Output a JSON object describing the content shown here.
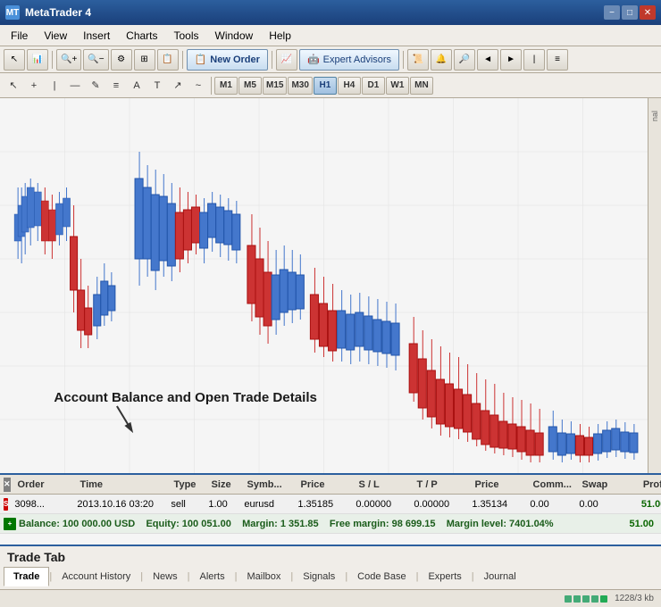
{
  "titlebar": {
    "title": "MetaTrader 4",
    "minimize": "−",
    "maximize": "□",
    "close": "✕"
  },
  "menu": {
    "items": [
      "File",
      "View",
      "Insert",
      "Charts",
      "Tools",
      "Window",
      "Help"
    ]
  },
  "toolbar1": {
    "new_order": "New Order",
    "expert_advisors": "Expert Advisors"
  },
  "toolbar2": {
    "timeframes": [
      "M1",
      "M5",
      "M15",
      "M30",
      "H1",
      "H4",
      "D1",
      "W1",
      "MN"
    ],
    "active_tf": "H1"
  },
  "chart": {
    "annotation": "Account Balance and Open Trade Details"
  },
  "trade_table": {
    "headers": [
      "Order",
      "Time",
      "Type",
      "Size",
      "Symb...",
      "Price",
      "S / L",
      "T / P",
      "Price",
      "Comm...",
      "Swap",
      "Profit"
    ],
    "rows": [
      {
        "order": "3098...",
        "time": "2013.10.16 03:20",
        "type": "sell",
        "size": "1.00",
        "symbol": "eurusd",
        "price": "1.35185",
        "sl": "0.00000",
        "tp": "0.00000",
        "price2": "1.35134",
        "comm": "0.00",
        "swap": "0.00",
        "profit": "51.00"
      }
    ],
    "balance_row": "Balance: 100 000.00 USD   Equity: 100 051.00   Margin: 1 351.85   Free margin: 98 699.15   Margin level: 7401.04%",
    "balance_profit": "51.00"
  },
  "tabs": {
    "items": [
      "Trade",
      "Account History",
      "News",
      "Alerts",
      "Mailbox",
      "Signals",
      "Code Base",
      "Experts",
      "Journal"
    ],
    "active": "Trade"
  },
  "labels": {
    "trade_tab": "Trade Tab"
  },
  "statusbar": {
    "memory": "1228/3 kb",
    "bars": "||||"
  }
}
